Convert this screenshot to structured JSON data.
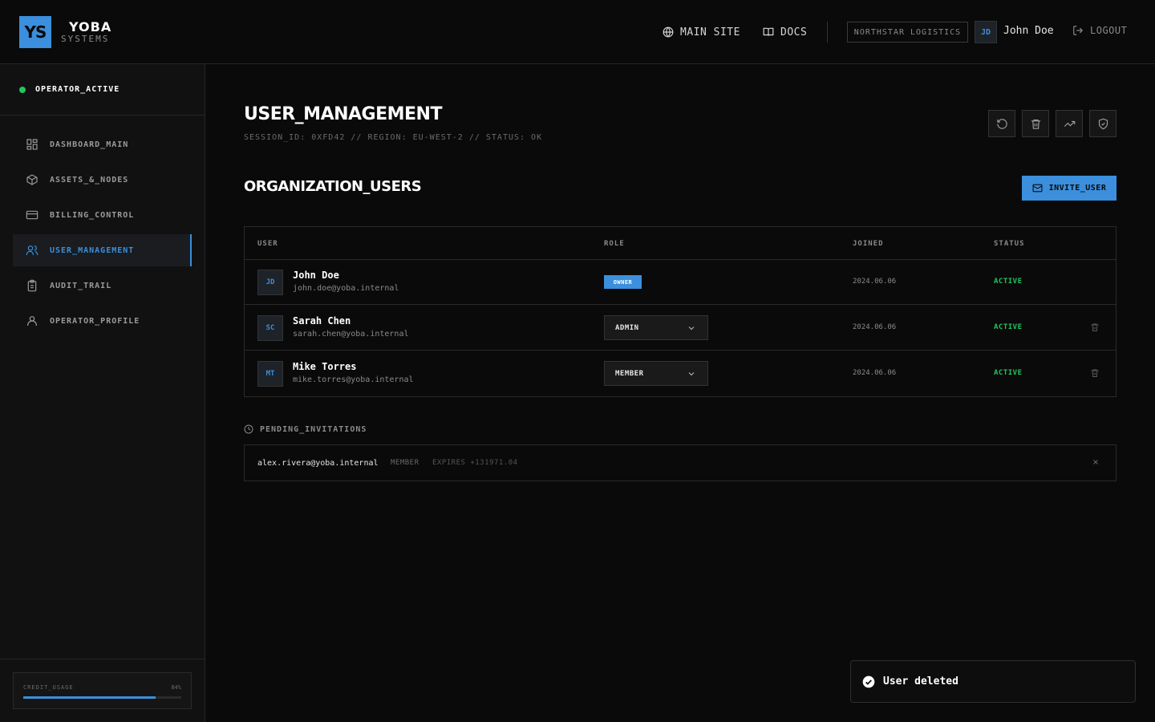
{
  "brand": {
    "logo": "YS",
    "name": "YOBA",
    "sub": "SYSTEMS",
    "accent": "#3b8fdc"
  },
  "header": {
    "main_site": "MAIN SITE",
    "docs": "DOCS",
    "org": "NORTHSTAR LOGISTICS",
    "avatar": "JD",
    "user": "John Doe",
    "logout": "LOGOUT"
  },
  "sidebar": {
    "status": "OPERATOR_ACTIVE",
    "items": [
      {
        "label": "DASHBOARD_MAIN",
        "icon": "dashboard-icon"
      },
      {
        "label": "ASSETS_&_NODES",
        "icon": "box-icon"
      },
      {
        "label": "BILLING_CONTROL",
        "icon": "credit-card-icon"
      },
      {
        "label": "USER_MANAGEMENT",
        "icon": "users-icon"
      },
      {
        "label": "AUDIT_TRAIL",
        "icon": "clipboard-icon"
      },
      {
        "label": "OPERATOR_PROFILE",
        "icon": "user-icon"
      }
    ],
    "active_index": 3,
    "credit": {
      "label": "CREDIT_USAGE",
      "percent_text": "84%",
      "percent": 84
    }
  },
  "main": {
    "title": "USER_MANAGEMENT",
    "session": "SESSION_ID: 0XFD42 // REGION: EU-WEST-2 // STATUS: OK",
    "section_title": "ORGANIZATION_USERS",
    "invite_label": "INVITE_USER",
    "columns": {
      "user": "USER",
      "role": "ROLE",
      "joined": "JOINED",
      "status": "STATUS"
    },
    "users": [
      {
        "initials": "JD",
        "name": "John Doe",
        "email": "john.doe@yoba.internal",
        "role": "OWNER",
        "joined": "2024.06.06",
        "status": "ACTIVE"
      },
      {
        "initials": "SC",
        "name": "Sarah Chen",
        "email": "sarah.chen@yoba.internal",
        "role": "ADMIN",
        "joined": "2024.06.06",
        "status": "ACTIVE"
      },
      {
        "initials": "MT",
        "name": "Mike Torres",
        "email": "mike.torres@yoba.internal",
        "role": "MEMBER",
        "joined": "2024.06.06",
        "status": "ACTIVE"
      }
    ],
    "pending": {
      "title": "PENDING_INVITATIONS",
      "invites": [
        {
          "email": "alex.rivera@yoba.internal",
          "role": "MEMBER",
          "expires": "EXPIRES +131971.04"
        }
      ]
    }
  },
  "toast": {
    "text": "User deleted"
  },
  "colors": {
    "active": "#22c55e",
    "accent": "#3b8fdc",
    "background": "#0a0a0a"
  }
}
